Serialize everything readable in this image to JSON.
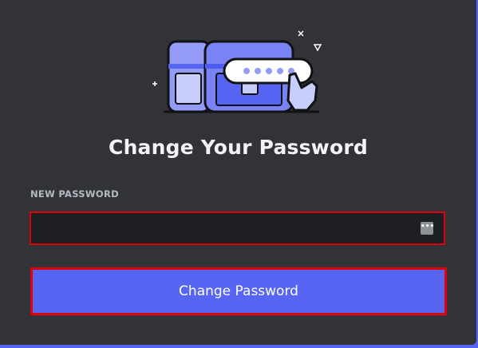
{
  "modal": {
    "title": "Change Your Password",
    "field_label": "NEW PASSWORD",
    "password_value": "",
    "password_manager_icon": "ellipsis-icon",
    "submit_label": "Change Password"
  },
  "colors": {
    "card_bg": "#313338",
    "input_bg": "#1e1f22",
    "accent": "#5865f2",
    "highlight_border": "#e0000a",
    "title_text": "#f2f3f5",
    "label_text": "#b5bac1",
    "illustration_purple": "#949cf7",
    "illustration_dark": "#4e5af0"
  }
}
